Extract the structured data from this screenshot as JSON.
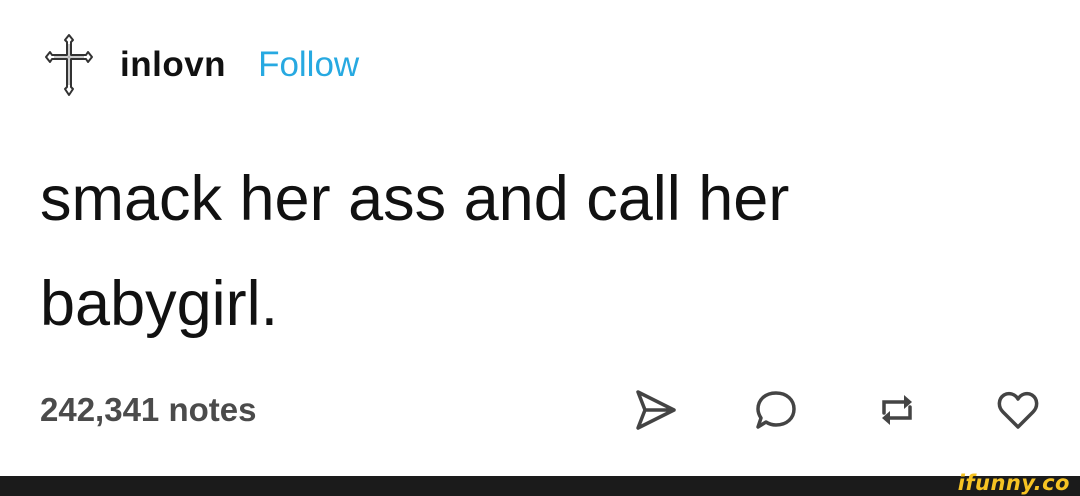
{
  "post": {
    "username": "inlovn",
    "follow_label": "Follow",
    "text": "smack her ass and call her babygirl.",
    "notes": "242,341 notes"
  },
  "actions": [
    {
      "icon": "send-icon"
    },
    {
      "icon": "reply-icon"
    },
    {
      "icon": "reblog-icon"
    },
    {
      "icon": "heart-icon"
    }
  ],
  "watermark": "ifunny.co",
  "colors": {
    "follow": "#27a9e1",
    "text": "#111111",
    "notes": "#4b4b4b",
    "icons": "#444444",
    "watermark": "#f6c323",
    "bottom_bar": "#1b1b1b"
  }
}
